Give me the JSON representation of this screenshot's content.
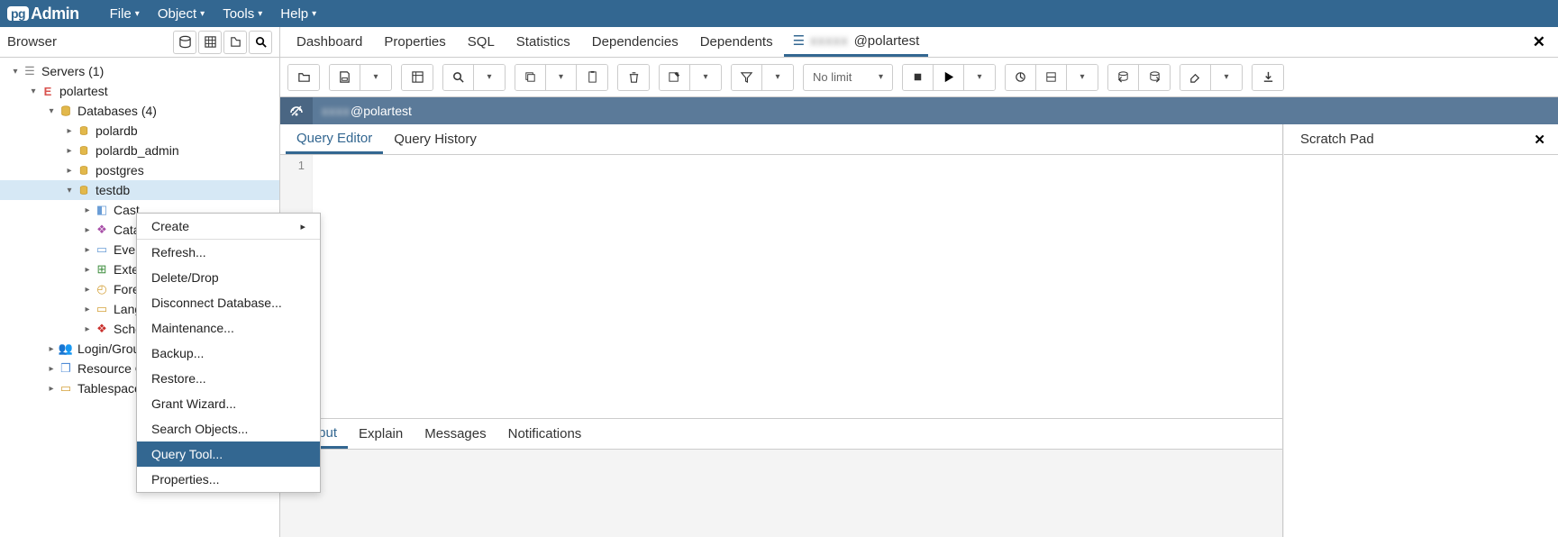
{
  "app": {
    "name": "Admin",
    "logo_prefix": "pg"
  },
  "menubar": {
    "items": [
      "File",
      "Object",
      "Tools",
      "Help"
    ]
  },
  "browser": {
    "title": "Browser"
  },
  "tree": {
    "servers_label": "Servers (1)",
    "conn_label": "polartest",
    "databases_label": "Databases (4)",
    "dbs": [
      "polardb",
      "polardb_admin",
      "postgres",
      "testdb"
    ],
    "children": [
      "Cast",
      "Cata",
      "Even",
      "Exte",
      "Fore",
      "Lang",
      "Sche"
    ],
    "login_label": "Login/Grou",
    "resource_label": "Resource G",
    "tablespace_label": "Tablespace"
  },
  "ctxmenu": {
    "items": [
      {
        "label": "Create",
        "submenu": true
      },
      {
        "sep": true
      },
      {
        "label": "Refresh..."
      },
      {
        "label": "Delete/Drop"
      },
      {
        "label": "Disconnect Database..."
      },
      {
        "label": "Maintenance..."
      },
      {
        "label": "Backup..."
      },
      {
        "label": "Restore..."
      },
      {
        "label": "Grant Wizard..."
      },
      {
        "label": "Search Objects..."
      },
      {
        "label": "Query Tool...",
        "highlight": true
      },
      {
        "label": "Properties..."
      }
    ]
  },
  "maintabs": {
    "items": [
      "Dashboard",
      "Properties",
      "SQL",
      "Statistics",
      "Dependencies",
      "Dependents"
    ],
    "conntab_blur": "xxxxx",
    "conntab_suffix": "@polartest"
  },
  "toolbar": {
    "nolimit_label": "No limit"
  },
  "connbar": {
    "blur": "xxxx",
    "suffix": "@polartest"
  },
  "editor_tabs": {
    "items": [
      "Query Editor",
      "Query History"
    ],
    "active": 0
  },
  "scratch": {
    "title": "Scratch Pad"
  },
  "gutter": {
    "line1": "1"
  },
  "output_tabs": {
    "items": [
      "Output",
      "Explain",
      "Messages",
      "Notifications"
    ],
    "active": 0
  }
}
